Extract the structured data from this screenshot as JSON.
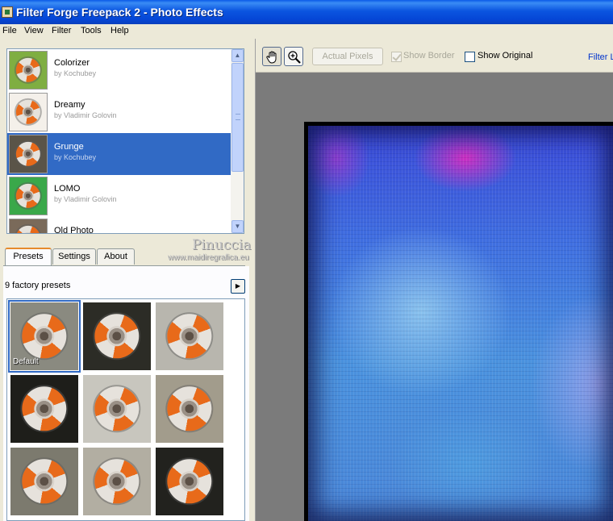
{
  "window": {
    "title": "Filter Forge Freepack 2 - Photo Effects"
  },
  "menu": [
    "File",
    "View",
    "Filter",
    "Tools",
    "Help"
  ],
  "filters": [
    {
      "name": "Colorizer",
      "author": "by Kochubey",
      "selected": false
    },
    {
      "name": "Dreamy",
      "author": "by Vladimir Golovin",
      "selected": false
    },
    {
      "name": "Grunge",
      "author": "by Kochubey",
      "selected": true
    },
    {
      "name": "LOMO",
      "author": "by Vladimir Golovin",
      "selected": false
    },
    {
      "name": "Old Photo",
      "author": "",
      "selected": false
    }
  ],
  "watermark": {
    "name": "Pinuccia",
    "url": "www.maidiregrafica.eu"
  },
  "tabs": [
    "Presets",
    "Settings",
    "About"
  ],
  "active_tab": "Presets",
  "presets": {
    "count_label": "9 factory presets",
    "items": [
      {
        "label": "Default",
        "selected": true
      },
      {
        "label": "",
        "selected": false
      },
      {
        "label": "",
        "selected": false
      },
      {
        "label": "",
        "selected": false
      },
      {
        "label": "",
        "selected": false
      },
      {
        "label": "",
        "selected": false
      },
      {
        "label": "",
        "selected": false
      },
      {
        "label": "",
        "selected": false
      },
      {
        "label": "",
        "selected": false
      }
    ]
  },
  "toolbar": {
    "actual_pixels": "Actual Pixels",
    "show_border": "Show Border",
    "show_border_checked": true,
    "show_border_enabled": false,
    "show_original": "Show Original",
    "show_original_checked": false,
    "filter_link": "Filter L"
  },
  "icons": {
    "hand_tool": "hand-icon",
    "zoom_tool": "zoom-in-icon",
    "scroll_up": "chevron-up-icon",
    "scroll_down": "chevron-down-icon",
    "presets_menu": "chevron-right-icon"
  },
  "colors": {
    "selection": "#316ac5",
    "titlebar": "#0a5ae8",
    "tab_accent": "#e68b2c",
    "link": "#0033cc"
  }
}
